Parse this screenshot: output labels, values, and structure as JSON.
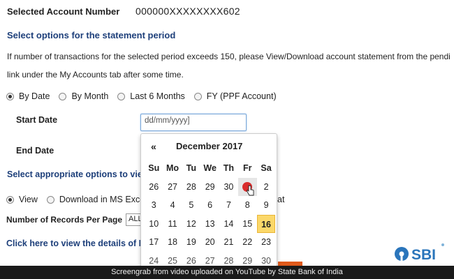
{
  "account": {
    "label": "Selected Account Number",
    "value": "000000XXXXXXXX602"
  },
  "period_section": {
    "title": "Select options for the statement period"
  },
  "info_text": {
    "line1": "If number of transactions for the selected period exceeds 150, please View/Download account statement from the pendi",
    "line2": "link under the My Accounts tab after some time."
  },
  "period_options": [
    {
      "label": "By Date",
      "checked": true
    },
    {
      "label": "By Month",
      "checked": false
    },
    {
      "label": "Last 6 Months",
      "checked": false
    },
    {
      "label": "FY (PPF Account)",
      "checked": false
    }
  ],
  "start_date": {
    "label": "Start Date",
    "placeholder": "dd/mm/yyyy]"
  },
  "end_date": {
    "label": "End Date"
  },
  "options_section": {
    "title": "Select appropriate options to view"
  },
  "view_options": [
    {
      "label": "View",
      "checked": true
    },
    {
      "label": "Download in MS Exce",
      "checked": false
    },
    {
      "label": "at",
      "checked": false
    }
  ],
  "records": {
    "label": "Number of Records Per Page",
    "value": "ALL"
  },
  "details_link": {
    "text": "Click here to view the details of M"
  },
  "calendar": {
    "prev": "«",
    "title": "December 2017",
    "days": [
      "Su",
      "Mo",
      "Tu",
      "We",
      "Th",
      "Fr",
      "Sa"
    ],
    "weeks": [
      [
        "26",
        "27",
        "28",
        "29",
        "30",
        "1",
        "2"
      ],
      [
        "3",
        "4",
        "5",
        "6",
        "7",
        "8",
        "9"
      ],
      [
        "10",
        "11",
        "12",
        "13",
        "14",
        "15",
        "16"
      ],
      [
        "17",
        "18",
        "19",
        "20",
        "21",
        "22",
        "23"
      ],
      [
        "24",
        "25",
        "26",
        "27",
        "28",
        "29",
        "30"
      ]
    ],
    "today": "16",
    "highlight_color": "#fbd86a"
  },
  "logo": {
    "text": "SBI"
  },
  "caption": "Screengrab from video uploaded on YouTube by State Bank of India"
}
